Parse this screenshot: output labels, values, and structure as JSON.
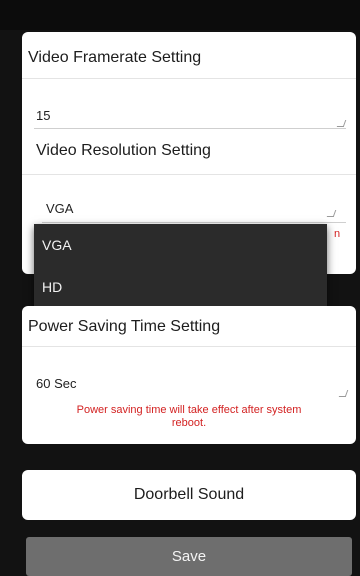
{
  "framerate": {
    "heading": "Video Framerate Setting",
    "value": "15"
  },
  "resolution": {
    "heading": "Video Resolution Setting",
    "value": "VGA",
    "hint_fragment": "n"
  },
  "resolution_menu": {
    "options": [
      "VGA",
      "HD"
    ]
  },
  "power_saving": {
    "heading": "Power Saving Time Setting",
    "value": "60 Sec",
    "hint_line1": "Power saving time will take effect after system",
    "hint_line2": "reboot."
  },
  "doorbell": {
    "label": "Doorbell Sound"
  },
  "save": {
    "label": "Save"
  },
  "colors": {
    "background": "#121212",
    "card": "#ffffff",
    "menu": "#2b2b2b",
    "hint": "#d32222",
    "save_button": "#6e6e6e"
  }
}
